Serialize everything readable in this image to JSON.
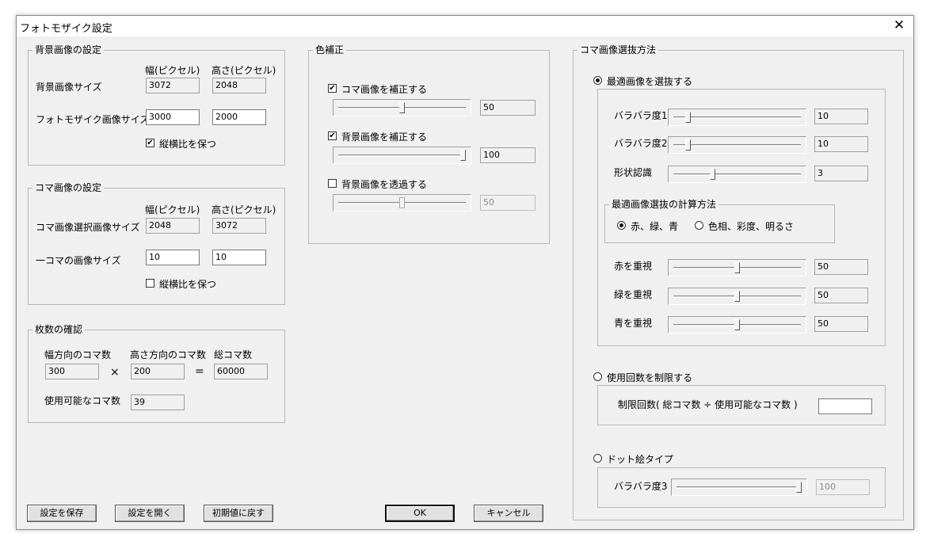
{
  "window": {
    "title": "フォトモザイク設定",
    "close_glyph": "✕"
  },
  "background": {
    "legend": "背景画像の設定",
    "col_width": "幅(ピクセル)",
    "col_height": "高さ(ピクセル)",
    "bg_size_label": "背景画像サイズ",
    "bg_width": "3072",
    "bg_height": "2048",
    "mosaic_size_label": "フォトモザイク画像サイズ",
    "mosaic_width": "3000",
    "mosaic_height": "2000",
    "keep_ratio_label": "縦横比を保つ",
    "keep_ratio_checked": true
  },
  "tile": {
    "legend": "コマ画像の設定",
    "col_width": "幅(ピクセル)",
    "col_height": "高さ(ピクセル)",
    "select_size_label": "コマ画像選択画像サイズ",
    "select_width": "2048",
    "select_height": "3072",
    "one_size_label": "一コマの画像サイズ",
    "one_width": "10",
    "one_height": "10",
    "keep_ratio_label": "縦横比を保つ",
    "keep_ratio_checked": false
  },
  "count": {
    "legend": "枚数の確認",
    "h_label": "幅方向のコマ数",
    "v_label": "高さ方向のコマ数",
    "total_label": "総コマ数",
    "h_value": "300",
    "v_value": "200",
    "total_value": "60000",
    "times": "×",
    "equals": "=",
    "usable_label": "使用可能なコマ数",
    "usable_value": "39"
  },
  "color": {
    "legend": "色補正",
    "tile_correct_label": "コマ画像を補正する",
    "tile_correct_checked": true,
    "tile_correct_value": "50",
    "tile_correct_level": 50,
    "bg_correct_label": "背景画像を補正する",
    "bg_correct_checked": true,
    "bg_correct_value": "100",
    "bg_correct_level": 100,
    "bg_trans_label": "背景画像を透過する",
    "bg_trans_checked": false,
    "bg_trans_value": "50",
    "bg_trans_level": 50
  },
  "selection": {
    "legend": "コマ画像選抜方法",
    "best_label": "最適画像を選抜する",
    "best_selected": true,
    "vary1_label": "バラバラ度1",
    "vary1_value": "10",
    "vary1_level": 10,
    "vary2_label": "バラバラ度2",
    "vary2_value": "10",
    "vary2_level": 10,
    "shape_label": "形状認識",
    "shape_value": "3",
    "shape_level": 30,
    "calc_legend": "最適画像選抜の計算方法",
    "rgb_label": "赤、緑、青",
    "rgb_selected": true,
    "hsv_label": "色相、彩度、明るさ",
    "hsv_selected": false,
    "red_label": "赤を重視",
    "red_value": "50",
    "red_level": 50,
    "green_label": "緑を重視",
    "green_value": "50",
    "green_level": 50,
    "blue_label": "青を重視",
    "blue_value": "50",
    "blue_level": 50,
    "limit_label": "使用回数を制限する",
    "limit_selected": false,
    "limit_count_label": "制限回数( 総コマ数 ÷ 使用可能なコマ数 )",
    "limit_count_value": "",
    "dot_label": "ドット絵タイプ",
    "dot_selected": false,
    "vary3_label": "バラバラ度3",
    "vary3_value": "100",
    "vary3_level": 100
  },
  "buttons": {
    "save": "設定を保存",
    "open": "設定を開く",
    "reset": "初期値に戻す",
    "ok": "OK",
    "cancel": "キャンセル"
  }
}
